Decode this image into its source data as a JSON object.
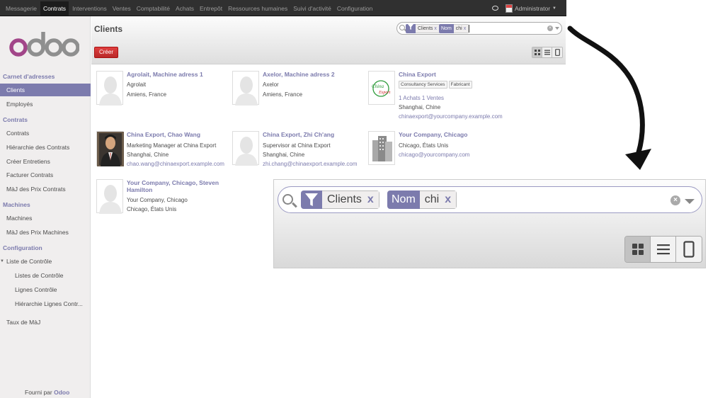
{
  "topnav": {
    "items": [
      "Messagerie",
      "Contrats",
      "Interventions",
      "Ventes",
      "Comptabilité",
      "Achats",
      "Entrepôt",
      "Ressources humaines",
      "Suivi d'activité",
      "Configuration"
    ],
    "active": "Contrats",
    "user": "Administrator"
  },
  "sidebar": {
    "logo": "odoo",
    "sections": [
      {
        "title": "Carnet d'adresses",
        "items": [
          "Clients",
          "Employés"
        ]
      },
      {
        "title": "Contrats",
        "items": [
          "Contrats",
          "Hiérarchie des Contrats",
          "Créer Entretiens",
          "Facturer Contrats",
          "MàJ des Prix Contrats"
        ]
      },
      {
        "title": "Machines",
        "items": [
          "Machines",
          "MàJ des Prix Machines"
        ]
      },
      {
        "title": "Configuration",
        "items": [
          "Liste de Contrôle",
          "Listes de Contrôle",
          "Lignes Contrôle",
          "Hiérarchie Lignes Contr...",
          "Taux de MàJ"
        ]
      }
    ],
    "active_item": "Clients",
    "powered_prefix": "Fourni par",
    "powered_brand": "Odoo"
  },
  "header": {
    "title": "Clients",
    "create_label": "Créer"
  },
  "search": {
    "facets": [
      {
        "category_icon": "filter-icon",
        "value": "Clients"
      },
      {
        "category": "Nom",
        "value": "chi"
      }
    ],
    "remove_label": "x"
  },
  "cards": [
    {
      "name": "Agrolait, Machine adress 1",
      "lines": [
        "Agrolait",
        "Amiens, France"
      ],
      "image": "placeholder"
    },
    {
      "name": "Axelor, Machine adress 2",
      "lines": [
        "Axelor",
        "Amiens, France"
      ],
      "image": "placeholder"
    },
    {
      "name": "China Export",
      "tags": [
        "Consultancy Services",
        "Fabricant"
      ],
      "stats": "1 Achats 1 Ventes",
      "lines": [
        "Shanghai, Chine"
      ],
      "email": "chinaexport@yourcompany.example.com",
      "image": "china-export-logo",
      "logo_line1": "China",
      "logo_line2": "Export"
    },
    {
      "name": "China Export, Chao Wang",
      "lines": [
        "Marketing Manager at China Export",
        "Shanghai, Chine"
      ],
      "email": "chao.wang@chinaexport.example.com",
      "image": "person-photo"
    },
    {
      "name": "China Export, Zhi Ch'ang",
      "lines": [
        "Supervisor at China Export",
        "Shanghai, Chine"
      ],
      "email": "zhi.chang@chinaexport.example.com",
      "image": "placeholder"
    },
    {
      "name": "Your Company, Chicago",
      "lines": [
        "Chicago, États Unis"
      ],
      "email": "chicago@yourcompany.com",
      "image": "buildings"
    },
    {
      "name": "Your Company, Chicago, Steven Hamilton",
      "lines": [
        "Your Company, Chicago",
        "Chicago, États Unis"
      ],
      "image": "placeholder"
    }
  ],
  "colors": {
    "accent": "#7c7bad",
    "create": "#dc3b3b",
    "topbar": "#303030"
  }
}
